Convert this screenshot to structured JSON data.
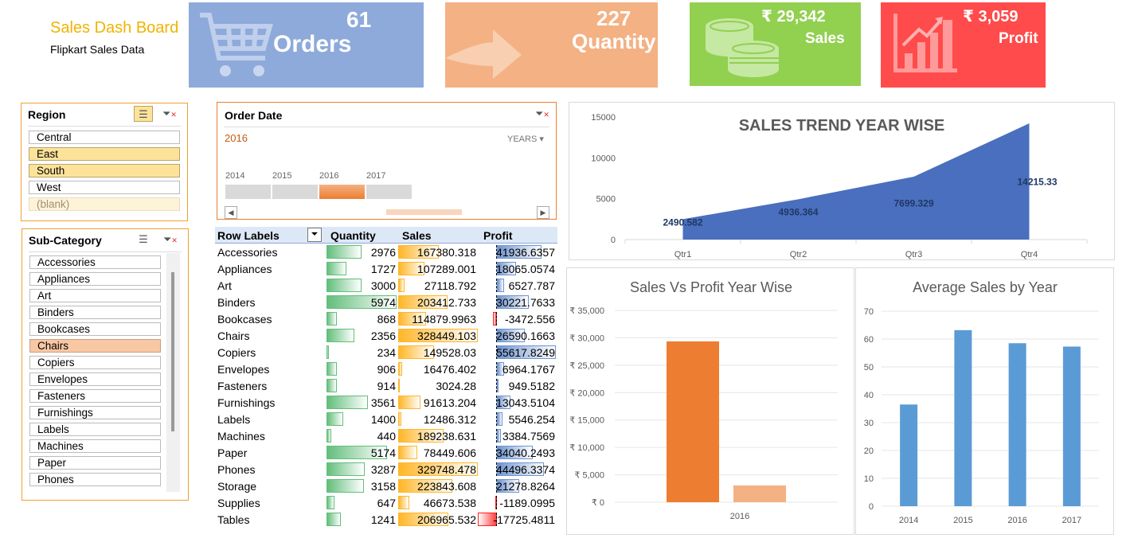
{
  "header": {
    "title": "Sales Dash Board",
    "subtitle": "Flipkart Sales Data"
  },
  "kpis": [
    {
      "value": "61",
      "label": "Orders",
      "color": "#8eaadb",
      "icon": "shopping-cart-icon"
    },
    {
      "value": "227",
      "label": "Quantity",
      "color": "#f4b183",
      "icon": "arrow-right-icon"
    },
    {
      "value": "₹ 29,342",
      "label": "Sales",
      "color": "#92d050",
      "icon": "coins-icon"
    },
    {
      "value": "₹ 3,059",
      "label": "Profit",
      "color": "#ff4b4b",
      "icon": "growth-chart-icon"
    }
  ],
  "region_slicer": {
    "title": "Region",
    "items": [
      {
        "label": "Central",
        "state": "normal"
      },
      {
        "label": "East",
        "state": "selected"
      },
      {
        "label": "South",
        "state": "selected"
      },
      {
        "label": "West",
        "state": "normal"
      },
      {
        "label": "(blank)",
        "state": "nodata"
      }
    ]
  },
  "subcat_slicer": {
    "title": "Sub-Category",
    "items": [
      {
        "label": "Accessories",
        "state": "normal"
      },
      {
        "label": "Appliances",
        "state": "normal"
      },
      {
        "label": "Art",
        "state": "normal"
      },
      {
        "label": "Binders",
        "state": "normal"
      },
      {
        "label": "Bookcases",
        "state": "normal"
      },
      {
        "label": "Chairs",
        "state": "highlight"
      },
      {
        "label": "Copiers",
        "state": "normal"
      },
      {
        "label": "Envelopes",
        "state": "normal"
      },
      {
        "label": "Fasteners",
        "state": "normal"
      },
      {
        "label": "Furnishings",
        "state": "normal"
      },
      {
        "label": "Labels",
        "state": "normal"
      },
      {
        "label": "Machines",
        "state": "normal"
      },
      {
        "label": "Paper",
        "state": "normal"
      },
      {
        "label": "Phones",
        "state": "normal"
      }
    ]
  },
  "timeline": {
    "title": "Order Date",
    "selected": "2016",
    "level": "YEARS",
    "years": [
      "2014",
      "2015",
      "2016",
      "2017"
    ],
    "selected_year": "2016"
  },
  "pivot": {
    "headers": {
      "labels": "Row Labels",
      "quantity": "Quantity",
      "sales": "Sales",
      "profit": "Profit"
    },
    "rows": [
      {
        "label": "Accessories",
        "quantity": "2976",
        "sales": "167380.318",
        "profit": "41936.6357",
        "q": 2976,
        "s": 167380.318,
        "p": 41936.6357
      },
      {
        "label": "Appliances",
        "quantity": "1727",
        "sales": "107289.001",
        "profit": "18065.0574",
        "q": 1727,
        "s": 107289.001,
        "p": 18065.0574
      },
      {
        "label": "Art",
        "quantity": "3000",
        "sales": "27118.792",
        "profit": "6527.787",
        "q": 3000,
        "s": 27118.792,
        "p": 6527.787
      },
      {
        "label": "Binders",
        "quantity": "5974",
        "sales": "203412.733",
        "profit": "30221.7633",
        "q": 5974,
        "s": 203412.733,
        "p": 30221.7633
      },
      {
        "label": "Bookcases",
        "quantity": "868",
        "sales": "114879.9963",
        "profit": "-3472.556",
        "q": 868,
        "s": 114879.9963,
        "p": -3472.556
      },
      {
        "label": "Chairs",
        "quantity": "2356",
        "sales": "328449.103",
        "profit": "26590.1663",
        "q": 2356,
        "s": 328449.103,
        "p": 26590.1663
      },
      {
        "label": "Copiers",
        "quantity": "234",
        "sales": "149528.03",
        "profit": "55617.8249",
        "q": 234,
        "s": 149528.03,
        "p": 55617.8249
      },
      {
        "label": "Envelopes",
        "quantity": "906",
        "sales": "16476.402",
        "profit": "6964.1767",
        "q": 906,
        "s": 16476.402,
        "p": 6964.1767
      },
      {
        "label": "Fasteners",
        "quantity": "914",
        "sales": "3024.28",
        "profit": "949.5182",
        "q": 914,
        "s": 3024.28,
        "p": 949.5182
      },
      {
        "label": "Furnishings",
        "quantity": "3561",
        "sales": "91613.204",
        "profit": "13043.5104",
        "q": 3561,
        "s": 91613.204,
        "p": 13043.5104
      },
      {
        "label": "Labels",
        "quantity": "1400",
        "sales": "12486.312",
        "profit": "5546.254",
        "q": 1400,
        "s": 12486.312,
        "p": 5546.254
      },
      {
        "label": "Machines",
        "quantity": "440",
        "sales": "189238.631",
        "profit": "3384.7569",
        "q": 440,
        "s": 189238.631,
        "p": 3384.7569
      },
      {
        "label": "Paper",
        "quantity": "5174",
        "sales": "78449.606",
        "profit": "34040.2493",
        "q": 5174,
        "s": 78449.606,
        "p": 34040.2493
      },
      {
        "label": "Phones",
        "quantity": "3287",
        "sales": "329748.478",
        "profit": "44496.3374",
        "q": 3287,
        "s": 329748.478,
        "p": 44496.3374
      },
      {
        "label": "Storage",
        "quantity": "3158",
        "sales": "223843.608",
        "profit": "21278.8264",
        "q": 3158,
        "s": 223843.608,
        "p": 21278.8264
      },
      {
        "label": "Supplies",
        "quantity": "647",
        "sales": "46673.538",
        "profit": "-1189.0995",
        "q": 647,
        "s": 46673.538,
        "p": -1189.0995
      },
      {
        "label": "Tables",
        "quantity": "1241",
        "sales": "206965.532",
        "profit": "-17725.4811",
        "q": 1241,
        "s": 206965.532,
        "p": -17725.4811
      }
    ]
  },
  "chart_data": [
    {
      "type": "area",
      "title": "SALES TREND YEAR WISE",
      "categories": [
        "Qtr1",
        "Qtr2",
        "Qtr3",
        "Qtr4"
      ],
      "values": [
        2490.582,
        4936.364,
        7699.329,
        14215.33
      ],
      "data_labels": [
        "2490.582",
        "4936.364",
        "7699.329",
        "14215.33"
      ],
      "ylim": [
        0,
        15000
      ],
      "yticks": [
        "0",
        "5000",
        "10000",
        "15000"
      ],
      "color": "#4a6fbe"
    },
    {
      "type": "bar",
      "title": "Sales Vs Profit Year Wise",
      "categories": [
        "2016"
      ],
      "series": [
        {
          "values": [
            29342
          ],
          "color": "#ed7d31"
        },
        {
          "values": [
            3059
          ],
          "color": "#f4b183"
        }
      ],
      "ylim": [
        0,
        35000
      ],
      "yticks": [
        "₹ 0",
        "₹ 5,000",
        "₹ 10,000",
        "₹ 15,000",
        "₹ 20,000",
        "₹ 25,000",
        "₹ 30,000",
        "₹ 35,000"
      ]
    },
    {
      "type": "bar",
      "title": "Average Sales by Year",
      "categories": [
        "2014",
        "2015",
        "2016",
        "2017"
      ],
      "values": [
        36.5,
        63.2,
        58.5,
        57.3
      ],
      "ylim": [
        0,
        70
      ],
      "yticks": [
        "0",
        "10",
        "20",
        "30",
        "40",
        "50",
        "60",
        "70"
      ],
      "color": "#5b9bd5"
    }
  ]
}
